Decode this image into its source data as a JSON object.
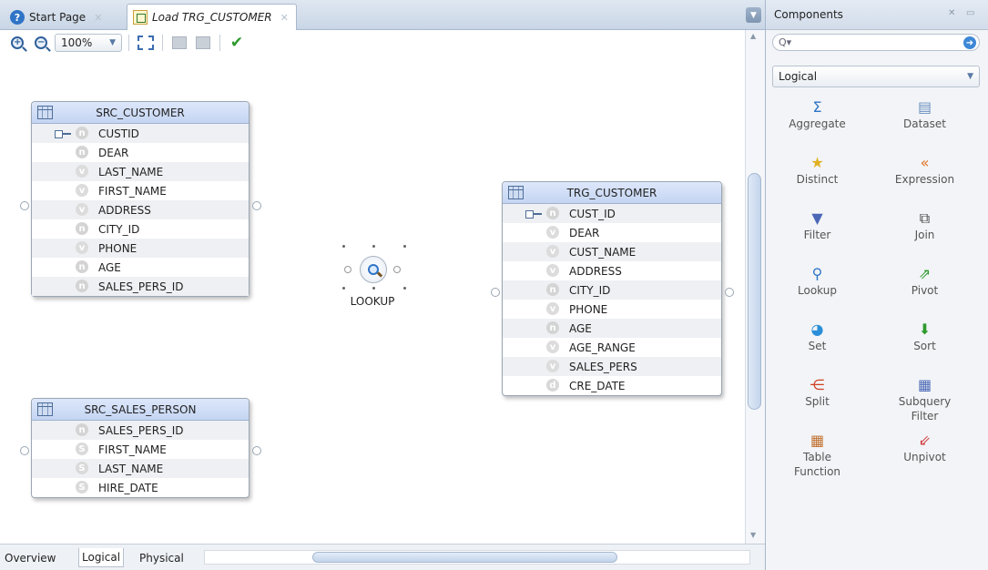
{
  "tabs": [
    {
      "label": "Start Page",
      "active": false
    },
    {
      "label": "Load TRG_CUSTOMER",
      "active": true
    }
  ],
  "toolbar": {
    "zoom": "100%"
  },
  "canvas": {
    "entities": {
      "src_customer": {
        "name": "SRC_CUSTOMER",
        "attributes": [
          {
            "name": "CUSTID",
            "type_badge": "n",
            "key": true
          },
          {
            "name": "DEAR",
            "type_badge": "n"
          },
          {
            "name": "LAST_NAME",
            "type_badge": "v"
          },
          {
            "name": "FIRST_NAME",
            "type_badge": "v"
          },
          {
            "name": "ADDRESS",
            "type_badge": "v"
          },
          {
            "name": "CITY_ID",
            "type_badge": "n"
          },
          {
            "name": "PHONE",
            "type_badge": "v"
          },
          {
            "name": "AGE",
            "type_badge": "n"
          },
          {
            "name": "SALES_PERS_ID",
            "type_badge": "n"
          }
        ]
      },
      "trg_customer": {
        "name": "TRG_CUSTOMER",
        "attributes": [
          {
            "name": "CUST_ID",
            "type_badge": "n",
            "key": true
          },
          {
            "name": "DEAR",
            "type_badge": "v"
          },
          {
            "name": "CUST_NAME",
            "type_badge": "v"
          },
          {
            "name": "ADDRESS",
            "type_badge": "v"
          },
          {
            "name": "CITY_ID",
            "type_badge": "n"
          },
          {
            "name": "PHONE",
            "type_badge": "v"
          },
          {
            "name": "AGE",
            "type_badge": "n"
          },
          {
            "name": "AGE_RANGE",
            "type_badge": "v"
          },
          {
            "name": "SALES_PERS",
            "type_badge": "v"
          },
          {
            "name": "CRE_DATE",
            "type_badge": "d"
          }
        ]
      },
      "src_sales_person": {
        "name": "SRC_SALES_PERSON",
        "attributes": [
          {
            "name": "SALES_PERS_ID",
            "type_badge": "n"
          },
          {
            "name": "FIRST_NAME",
            "type_badge": "S"
          },
          {
            "name": "LAST_NAME",
            "type_badge": "S"
          },
          {
            "name": "HIRE_DATE",
            "type_badge": "S"
          }
        ]
      }
    },
    "lookup": {
      "label": "LOOKUP"
    }
  },
  "bottom_tabs": [
    {
      "label": "Overview",
      "active": false
    },
    {
      "label": "Logical",
      "active": true
    },
    {
      "label": "Physical",
      "active": false
    }
  ],
  "palette": {
    "title": "Components",
    "search_placeholder": "",
    "selected_category": "Logical",
    "components": [
      {
        "label": "Aggregate",
        "icon": "sigma-icon",
        "glyph": "Σ",
        "color": "#2f74c6"
      },
      {
        "label": "Dataset",
        "icon": "dataset-icon",
        "glyph": "▤",
        "color": "#6a8fbf"
      },
      {
        "label": "Distinct",
        "icon": "star-icon",
        "glyph": "★",
        "color": "#e0b020"
      },
      {
        "label": "Expression",
        "icon": "expression-icon",
        "glyph": "«",
        "color": "#e07020"
      },
      {
        "label": "Filter",
        "icon": "filter-icon",
        "glyph": "▼",
        "color": "#4a67b5"
      },
      {
        "label": "Join",
        "icon": "join-icon",
        "glyph": "⧉",
        "color": "#444444"
      },
      {
        "label": "Lookup",
        "icon": "magnifier-icon",
        "glyph": "⚲",
        "color": "#2f74c6"
      },
      {
        "label": "Pivot",
        "icon": "pivot-icon",
        "glyph": "⇗",
        "color": "#2d9a2d"
      },
      {
        "label": "Set",
        "icon": "set-icon",
        "glyph": "◕",
        "color": "#2a8fd8"
      },
      {
        "label": "Sort",
        "icon": "sort-icon",
        "glyph": "⬇",
        "color": "#2d9a2d"
      },
      {
        "label": "Split",
        "icon": "split-icon",
        "glyph": "⋲",
        "color": "#d04020"
      },
      {
        "label": "Subquery\nFilter",
        "icon": "subquery-filter-icon",
        "glyph": "▦",
        "color": "#4a67b5"
      },
      {
        "label": "Table\nFunction",
        "icon": "table-function-icon",
        "glyph": "▦",
        "color": "#c07030"
      },
      {
        "label": "Unpivot",
        "icon": "unpivot-icon",
        "glyph": "⇙",
        "color": "#d03030"
      }
    ]
  }
}
